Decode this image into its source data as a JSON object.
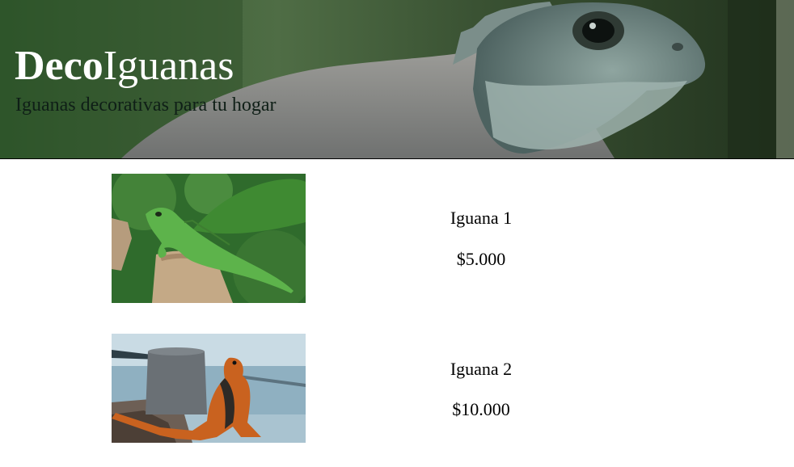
{
  "header": {
    "brand_bold": "Deco",
    "brand_regular": "Iguanas",
    "tagline": "Iguanas decorativas para tu hogar"
  },
  "products": [
    {
      "name": "Iguana 1",
      "price": "$5.000",
      "image": "green-iguana-on-stump-photo"
    },
    {
      "name": "Iguana 2",
      "price": "$10.000",
      "image": "orange-iguana-by-water-photo"
    }
  ],
  "colors": {
    "tagline": "#0f1f17",
    "brand": "#ffffff",
    "background": "#ffffff"
  }
}
